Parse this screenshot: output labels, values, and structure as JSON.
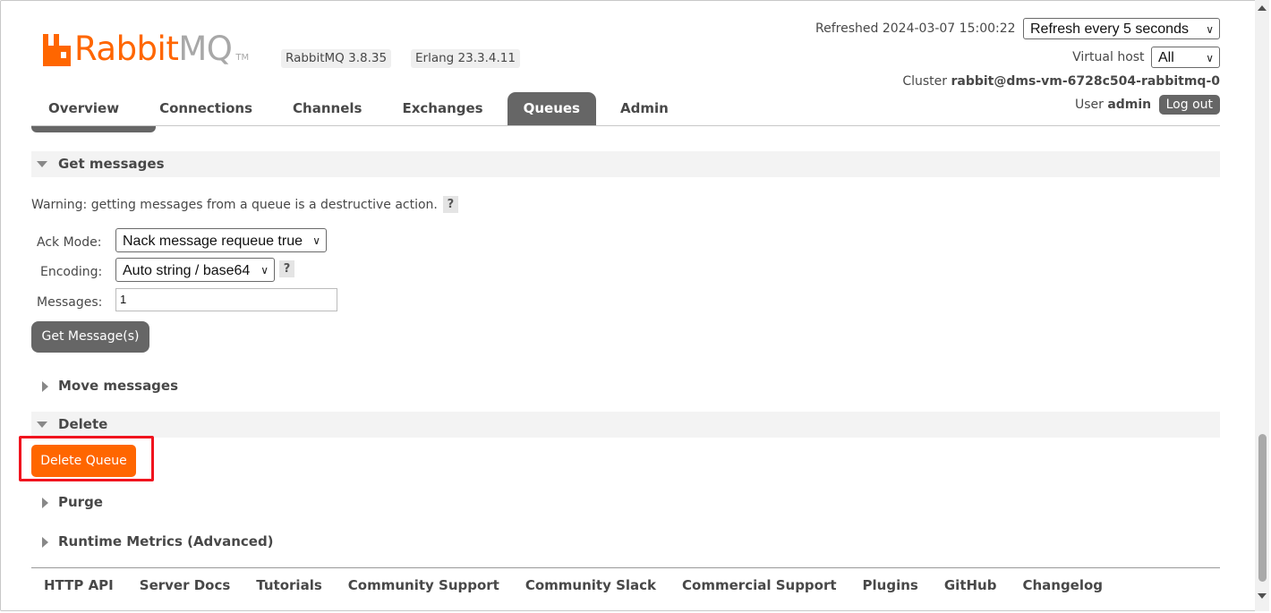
{
  "header": {
    "logo": {
      "brand": "Rabbit",
      "product": "MQ",
      "trademark": "TM"
    },
    "rabbitmq_version": "RabbitMQ 3.8.35",
    "erlang_version": "Erlang 23.3.4.11",
    "refreshed_label": "Refreshed 2024-03-07 15:00:22",
    "refresh_select": "Refresh every 5 seconds",
    "virtual_host_label": "Virtual host",
    "virtual_host_select": "All",
    "cluster_label": "Cluster",
    "cluster_name": "rabbit@dms-vm-6728c504-rabbitmq-0",
    "user_label": "User",
    "user_name": "admin",
    "logout_label": "Log out"
  },
  "nav": {
    "tabs": [
      "Overview",
      "Connections",
      "Channels",
      "Exchanges",
      "Queues",
      "Admin"
    ],
    "active": "Queues"
  },
  "get_messages": {
    "title": "Get messages",
    "warning": "Warning: getting messages from a queue is a destructive action.",
    "help": "?",
    "ack_mode_label": "Ack Mode:",
    "ack_mode_value": "Nack message requeue true",
    "encoding_label": "Encoding:",
    "encoding_value": "Auto string / base64",
    "messages_label": "Messages:",
    "messages_value": "1",
    "button": "Get Message(s)"
  },
  "move_messages": {
    "title": "Move messages"
  },
  "delete": {
    "title": "Delete",
    "button": "Delete Queue"
  },
  "purge": {
    "title": "Purge"
  },
  "runtime_metrics": {
    "title": "Runtime Metrics (Advanced)"
  },
  "footer": {
    "links": [
      "HTTP API",
      "Server Docs",
      "Tutorials",
      "Community Support",
      "Community Slack",
      "Commercial Support",
      "Plugins",
      "GitHub",
      "Changelog"
    ]
  },
  "colors": {
    "brand": "#ff6600",
    "highlight": "#f0141e",
    "tab_active": "#666666"
  }
}
